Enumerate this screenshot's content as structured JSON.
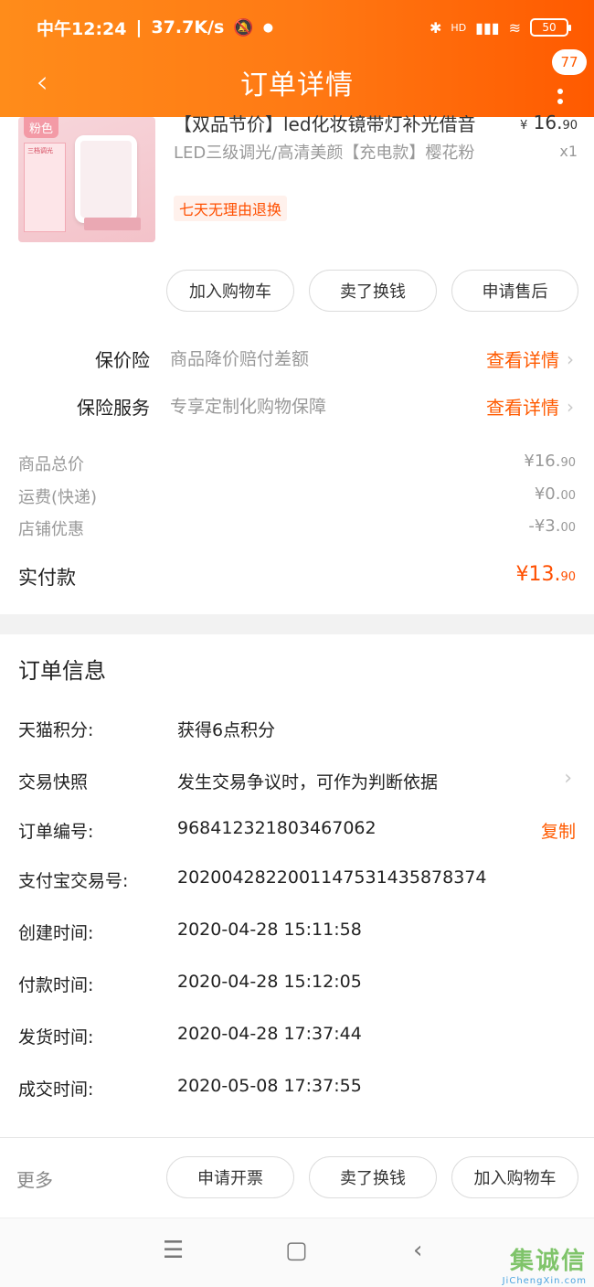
{
  "status_bar": {
    "time": "中午12:24",
    "speed": "37.7K/s",
    "network": "HD",
    "battery": "50"
  },
  "nav": {
    "title": "订单详情",
    "badge": "77"
  },
  "product": {
    "tag": "粉色",
    "list_title": "三档调光",
    "title": "【双品节价】led化妆镜带灯补光借音",
    "spec": "LED三级调光/高清美颜【充电款】樱花粉",
    "badge": "七天无理由退换",
    "price_yen": "¥",
    "price_int": "16.",
    "price_dec": "90",
    "qty": "x1"
  },
  "product_actions": {
    "add_cart": "加入购物车",
    "resell": "卖了换钱",
    "after_sale": "申请售后"
  },
  "services": [
    {
      "label": "保价险",
      "desc": "商品降价赔付差额",
      "link": "查看详情"
    },
    {
      "label": "保险服务",
      "desc": "专享定制化购物保障",
      "link": "查看详情"
    }
  ],
  "summary": {
    "goods_total_label": "商品总价",
    "goods_total_int": "¥16.",
    "goods_total_dec": "90",
    "shipping_label": "运费(快递)",
    "shipping_int": "¥0.",
    "shipping_dec": "00",
    "discount_label": "店铺优惠",
    "discount_int": "-¥3.",
    "discount_dec": "00",
    "paid_label": "实付款",
    "paid_int": "¥13.",
    "paid_dec": "90"
  },
  "order_info": {
    "title": "订单信息",
    "rows": [
      {
        "key": "天猫积分:",
        "value": "获得6点积分"
      },
      {
        "key": "交易快照",
        "value": "发生交易争议时，可作为判断依据"
      },
      {
        "key": "订单编号:",
        "value": "968412321803467062",
        "action": "复制"
      },
      {
        "key": "支付宝交易号:",
        "value": "2020042822001147531435878374"
      },
      {
        "key": "创建时间:",
        "value": "2020-04-28 15:11:58"
      },
      {
        "key": "付款时间:",
        "value": "2020-04-28 15:12:05"
      },
      {
        "key": "发货时间:",
        "value": "2020-04-28 17:37:44"
      },
      {
        "key": "成交时间:",
        "value": "2020-05-08 17:37:55"
      }
    ]
  },
  "bottom_bar": {
    "more": "更多",
    "invoice": "申请开票",
    "resell": "卖了换钱",
    "add_cart": "加入购物车"
  },
  "watermark": {
    "cn": "集诚信",
    "en": "JiChengXin.com"
  },
  "colors": {
    "accent": "#ff5a00",
    "header_start": "#ff8c1a",
    "header_end": "#ff5a00"
  }
}
